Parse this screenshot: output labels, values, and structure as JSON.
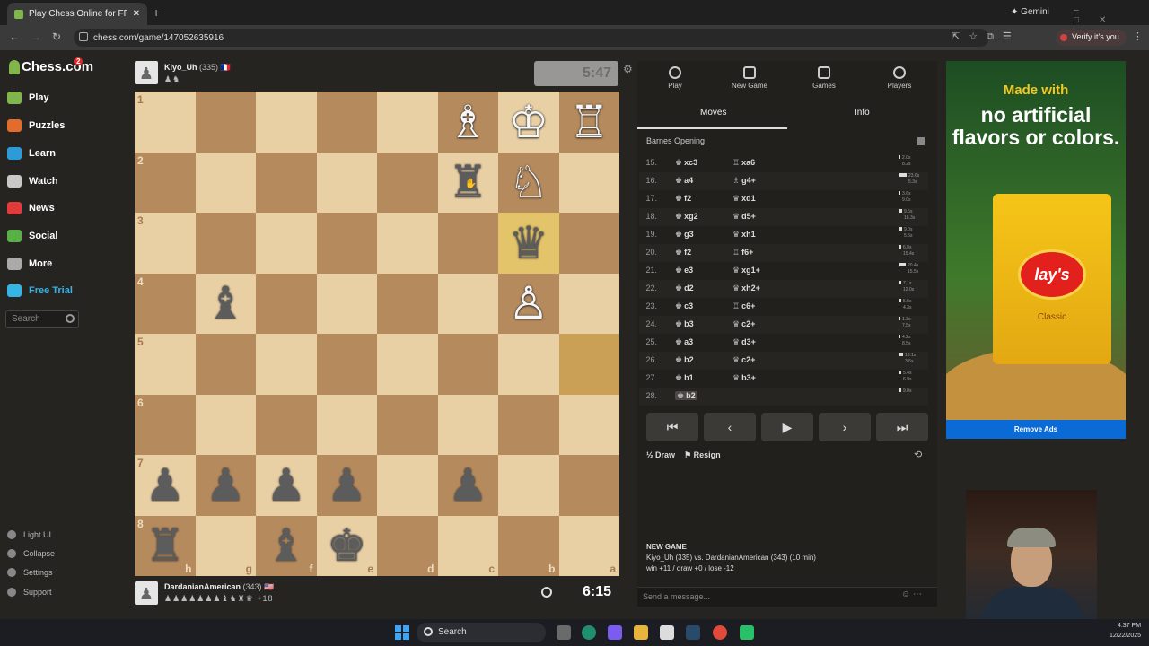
{
  "browser": {
    "tab_title": "Play Chess Online for FREE - 2",
    "url": "chess.com/game/147052635916",
    "gemini_label": "Gemini",
    "verify_label": "Verify it's you"
  },
  "sidebar": {
    "logo": "Chess.com",
    "logo_badge": "2",
    "items": [
      {
        "label": "Play",
        "color": "#81b64c"
      },
      {
        "label": "Puzzles",
        "color": "#e36b2c"
      },
      {
        "label": "Learn",
        "color": "#2a9dd8"
      },
      {
        "label": "Watch",
        "color": "#c8c8c8"
      },
      {
        "label": "News",
        "color": "#e23b3b"
      },
      {
        "label": "Social",
        "color": "#57b045"
      },
      {
        "label": "More",
        "color": "#aaaaaa"
      },
      {
        "label": "Free Trial",
        "color": "#35b4e8"
      }
    ],
    "search_placeholder": "Search",
    "bottom": [
      "Light UI",
      "Collapse",
      "Settings",
      "Support"
    ]
  },
  "top_player": {
    "name": "Kiyo_Uh",
    "rating": "(335)",
    "flag": "🇫🇷",
    "captured": "♟♞",
    "clock": "5:47"
  },
  "bottom_player": {
    "name": "DardanianAmerican",
    "rating": "(343)",
    "flag": "🇺🇸",
    "captured": "♟♟♟♟♟♟♟♝♞♜♛",
    "advantage": "+18",
    "clock": "6:15"
  },
  "board": {
    "ranks": [
      "1",
      "2",
      "3",
      "4",
      "5",
      "6",
      "7",
      "8"
    ],
    "files": [
      "h",
      "g",
      "f",
      "e",
      "d",
      "c",
      "b",
      "a"
    ],
    "highlight": [
      "2-6",
      "4-7"
    ],
    "pieces": [
      {
        "r": 0,
        "c": 5,
        "g": "♗",
        "w": true
      },
      {
        "r": 0,
        "c": 6,
        "g": "♔",
        "w": true
      },
      {
        "r": 0,
        "c": 7,
        "g": "♖",
        "w": true
      },
      {
        "r": 1,
        "c": 5,
        "g": "♜",
        "w": false
      },
      {
        "r": 1,
        "c": 6,
        "g": "♘",
        "w": true
      },
      {
        "r": 2,
        "c": 6,
        "g": "♛",
        "w": false
      },
      {
        "r": 3,
        "c": 1,
        "g": "♝",
        "w": false
      },
      {
        "r": 3,
        "c": 6,
        "g": "♙",
        "w": true
      },
      {
        "r": 6,
        "c": 0,
        "g": "♟",
        "w": false
      },
      {
        "r": 6,
        "c": 1,
        "g": "♟",
        "w": false
      },
      {
        "r": 6,
        "c": 2,
        "g": "♟",
        "w": false
      },
      {
        "r": 6,
        "c": 3,
        "g": "♟",
        "w": false
      },
      {
        "r": 6,
        "c": 5,
        "g": "♟",
        "w": false
      },
      {
        "r": 7,
        "c": 0,
        "g": "♜",
        "w": false
      },
      {
        "r": 7,
        "c": 2,
        "g": "♝",
        "w": false
      },
      {
        "r": 7,
        "c": 3,
        "g": "♚",
        "w": false
      }
    ]
  },
  "panel": {
    "tabs": [
      "Play",
      "New Game",
      "Games",
      "Players"
    ],
    "subtabs": [
      "Moves",
      "Info"
    ],
    "opening": "Barnes Opening",
    "moves": [
      {
        "n": "15.",
        "w": "xc3",
        "wg": "♚",
        "b": "xa6",
        "bg": "♖",
        "tw": "2.0s",
        "tb": "8.2s",
        "bw": 1
      },
      {
        "n": "16.",
        "w": "a4",
        "wg": "♚",
        "b": "g4+",
        "bg": "♗",
        "tw": "23.6s",
        "tb": "5.3s",
        "bw": 8
      },
      {
        "n": "17.",
        "w": "f2",
        "wg": "♚",
        "b": "xd1",
        "bg": "♛",
        "tw": "3.6s",
        "tb": "9.0s",
        "bw": 1
      },
      {
        "n": "18.",
        "w": "xg2",
        "wg": "♚",
        "b": "d5+",
        "bg": "♛",
        "tw": "9.5s",
        "tb": "16.3s",
        "bw": 3
      },
      {
        "n": "19.",
        "w": "g3",
        "wg": "♚",
        "b": "xh1",
        "bg": "♛",
        "tw": "9.0s",
        "tb": "5.6s",
        "bw": 3
      },
      {
        "n": "20.",
        "w": "f2",
        "wg": "♚",
        "b": "f6+",
        "bg": "♖",
        "tw": "6.8s",
        "tb": "15.4s",
        "bw": 2
      },
      {
        "n": "21.",
        "w": "e3",
        "wg": "♚",
        "b": "xg1+",
        "bg": "♛",
        "tw": "20.4s",
        "tb": "15.5s",
        "bw": 7
      },
      {
        "n": "22.",
        "w": "d2",
        "wg": "♚",
        "b": "xh2+",
        "bg": "♛",
        "tw": "7.1s",
        "tb": "12.0s",
        "bw": 2
      },
      {
        "n": "23.",
        "w": "c3",
        "wg": "♚",
        "b": "c6+",
        "bg": "♖",
        "tw": "5.5s",
        "tb": "4.3s",
        "bw": 2
      },
      {
        "n": "24.",
        "w": "b3",
        "wg": "♚",
        "b": "c2+",
        "bg": "♛",
        "tw": "1.3s",
        "tb": "7.5s",
        "bw": 1
      },
      {
        "n": "25.",
        "w": "a3",
        "wg": "♚",
        "b": "d3+",
        "bg": "♛",
        "tw": "4.2s",
        "tb": "8.5s",
        "bw": 1
      },
      {
        "n": "26.",
        "w": "b2",
        "wg": "♚",
        "b": "c2+",
        "bg": "♛",
        "tw": "13.1s",
        "tb": "3.6s",
        "bw": 4
      },
      {
        "n": "27.",
        "w": "b1",
        "wg": "♚",
        "b": "b3+",
        "bg": "♛",
        "tw": "5.4s",
        "tb": "6.9s",
        "bw": 2
      },
      {
        "n": "28.",
        "w": "b2",
        "wg": "♚",
        "b": "",
        "bg": "",
        "tw": "9.0s",
        "tb": "",
        "bw": 2
      }
    ],
    "controls": [
      "⏮",
      "‹",
      "▶",
      "›",
      "⏭"
    ],
    "draw_icon": "½",
    "draw": "Draw",
    "resign": "Resign",
    "new_game_title": "NEW GAME",
    "new_game_line1": "Kiyo_Uh (335) vs. DardanianAmerican (343) (10 min)",
    "new_game_line2": "win +11 / draw +0 / lose -12",
    "message_placeholder": "Send a message..."
  },
  "ad": {
    "headline1": "Made with",
    "headline2": "no artificial flavors or colors.",
    "brand": "lay's",
    "variant": "Classic",
    "remove": "Remove Ads"
  },
  "taskbar": {
    "search": "Search",
    "time": "4:37 PM",
    "date": "12/22/2025"
  }
}
